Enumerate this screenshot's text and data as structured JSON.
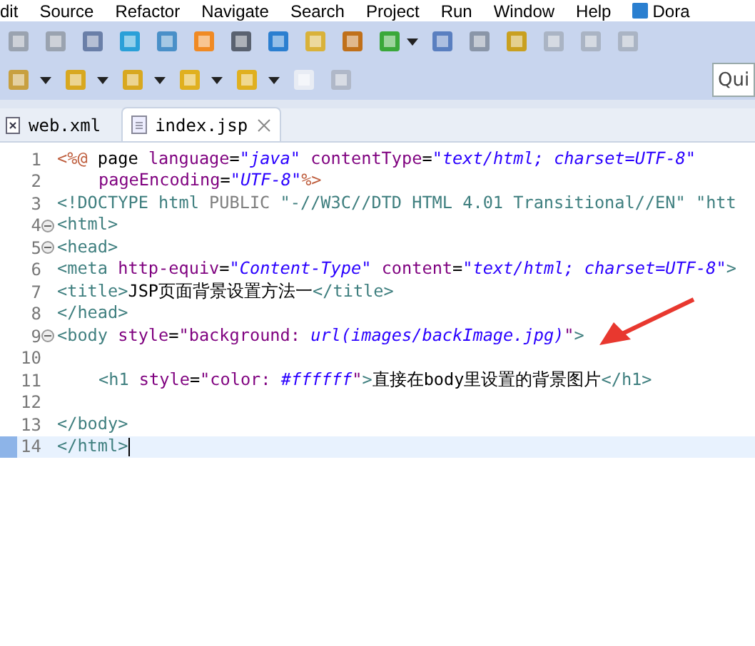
{
  "menu_bar": [
    "dit",
    "Source",
    "Refactor",
    "Navigate",
    "Search",
    "Project",
    "Run",
    "Window",
    "Help",
    "Dora"
  ],
  "quick_access": {
    "placeholder": "Qui"
  },
  "tabs": [
    {
      "label": "web.xml",
      "kind": "xml",
      "selected": false
    },
    {
      "label": "index.jsp",
      "kind": "jsp",
      "selected": true
    }
  ],
  "editor": {
    "lines": [
      {
        "number": "1",
        "fold": false,
        "current": false,
        "indented": false,
        "tokens": [
          {
            "kind": "directive",
            "text": "<%@"
          },
          {
            "kind": "plain",
            "text": " page "
          },
          {
            "kind": "attr",
            "text": "language"
          },
          {
            "kind": "plain",
            "text": "="
          },
          {
            "kind": "string",
            "text": "\"java\" "
          },
          {
            "kind": "attr",
            "text": "contentType"
          },
          {
            "kind": "plain",
            "text": "="
          },
          {
            "kind": "string",
            "text": "\"text/html; charset=UTF-8\""
          }
        ]
      },
      {
        "number": "2",
        "fold": false,
        "current": false,
        "indented": true,
        "tokens": [
          {
            "kind": "attr",
            "text": "pageEncoding"
          },
          {
            "kind": "plain",
            "text": "="
          },
          {
            "kind": "string",
            "text": "\"UTF-8\""
          },
          {
            "kind": "directive",
            "text": "%>"
          }
        ]
      },
      {
        "number": "3",
        "fold": false,
        "current": false,
        "indented": false,
        "tokens": [
          {
            "kind": "tag",
            "text": "<!DOCTYPE html "
          },
          {
            "kind": "doctype",
            "text": "PUBLIC"
          },
          {
            "kind": "tag",
            "text": " \"-//W3C//DTD HTML 4.01 Transitional//EN\" \"htt"
          }
        ]
      },
      {
        "number": "4",
        "fold": true,
        "current": false,
        "indented": false,
        "tokens": [
          {
            "kind": "tag",
            "text": "<html>"
          }
        ]
      },
      {
        "number": "5",
        "fold": true,
        "current": false,
        "indented": false,
        "tokens": [
          {
            "kind": "tag",
            "text": "<head>"
          }
        ]
      },
      {
        "number": "6",
        "fold": false,
        "current": false,
        "indented": false,
        "tokens": [
          {
            "kind": "tag",
            "text": "<meta "
          },
          {
            "kind": "attr",
            "text": "http-equiv"
          },
          {
            "kind": "plain",
            "text": "="
          },
          {
            "kind": "string",
            "text": "\"Content-Type\" "
          },
          {
            "kind": "attr",
            "text": "content"
          },
          {
            "kind": "plain",
            "text": "="
          },
          {
            "kind": "string",
            "text": "\"text/html; charset=UTF-8\""
          },
          {
            "kind": "tag",
            "text": ">"
          }
        ]
      },
      {
        "number": "7",
        "fold": false,
        "current": false,
        "indented": false,
        "tokens": [
          {
            "kind": "tag",
            "text": "<title>"
          },
          {
            "kind": "plain",
            "text": "JSP页面背景设置方法一"
          },
          {
            "kind": "tag",
            "text": "</title>"
          }
        ]
      },
      {
        "number": "8",
        "fold": false,
        "current": false,
        "indented": false,
        "tokens": [
          {
            "kind": "tag",
            "text": "</head>"
          }
        ]
      },
      {
        "number": "9",
        "fold": true,
        "current": false,
        "indented": false,
        "tokens": [
          {
            "kind": "tag",
            "text": "<body "
          },
          {
            "kind": "attr",
            "text": "style"
          },
          {
            "kind": "plain",
            "text": "="
          },
          {
            "kind": "css",
            "text": "\"background: "
          },
          {
            "kind": "string",
            "text": "url(images/backImage.jpg)"
          },
          {
            "kind": "css",
            "text": "\""
          },
          {
            "kind": "tag",
            "text": ">"
          }
        ]
      },
      {
        "number": "10",
        "fold": false,
        "current": false
      },
      {
        "number": "11",
        "fold": false,
        "current": false,
        "indented": true,
        "tokens": [
          {
            "kind": "tag",
            "text": "<h1 "
          },
          {
            "kind": "attr",
            "text": "style"
          },
          {
            "kind": "plain",
            "text": "="
          },
          {
            "kind": "css",
            "text": "\"color: "
          },
          {
            "kind": "string",
            "text": "#ffffff"
          },
          {
            "kind": "css",
            "text": "\""
          },
          {
            "kind": "tag",
            "text": ">"
          },
          {
            "kind": "plain",
            "text": "直接在body里设置的背景图片"
          },
          {
            "kind": "tag",
            "text": "</h1>"
          }
        ]
      },
      {
        "number": "12",
        "fold": false,
        "current": false
      },
      {
        "number": "13",
        "fold": false,
        "current": false,
        "indented": false,
        "tokens": [
          {
            "kind": "tag",
            "text": "</body>"
          }
        ]
      },
      {
        "number": "14",
        "fold": false,
        "current": true,
        "indented": false,
        "tokens": [
          {
            "kind": "tag",
            "text": "</html>"
          }
        ]
      }
    ]
  }
}
